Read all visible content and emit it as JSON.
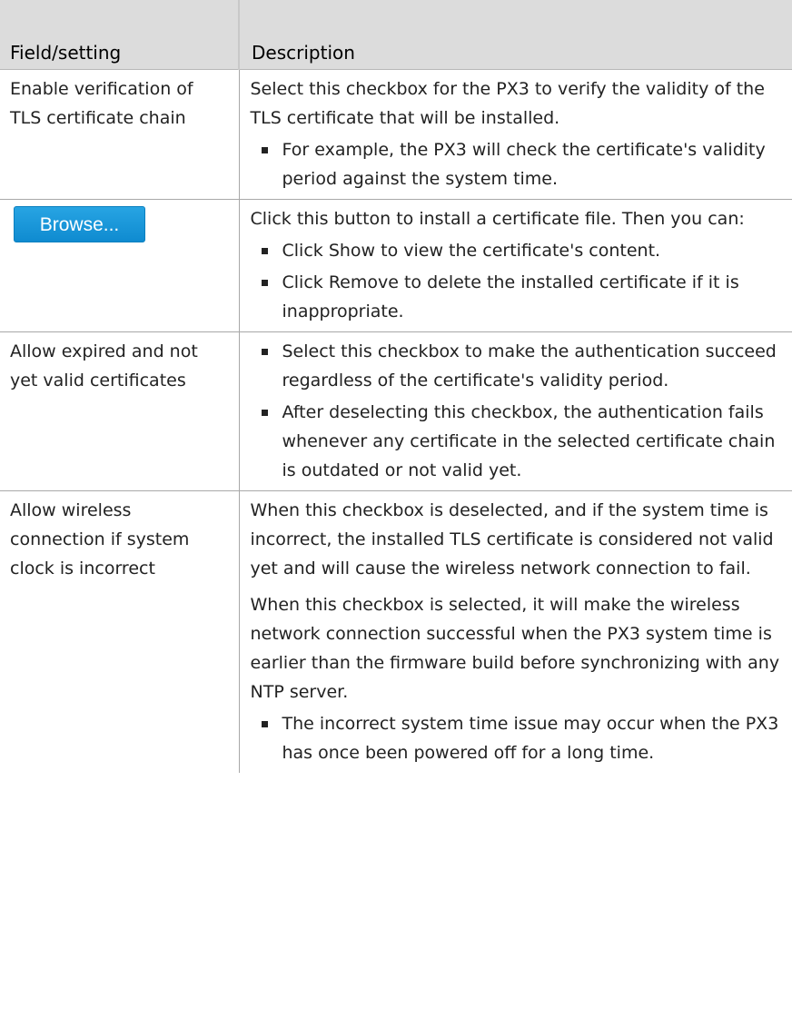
{
  "table": {
    "headers": [
      "Field/setting",
      "Description"
    ],
    "rows": [
      {
        "field": "Enable verification of TLS certificate chain",
        "paragraphs": [
          "Select this checkbox for the PX3 to verify the validity of the TLS certificate that will be installed."
        ],
        "bullets": [
          "For example, the PX3 will check the certificate's validity period against the system time."
        ]
      },
      {
        "field_button": "Browse...",
        "paragraphs": [
          "Click this button to install a certificate file. Then you can:"
        ],
        "bullets": [
          "Click Show to view the certificate's content.",
          "Click Remove to delete the installed certificate if it is inappropriate."
        ]
      },
      {
        "field": "Allow expired and not yet valid certificates",
        "paragraphs": [],
        "bullets": [
          "Select this checkbox to make the authentication succeed regardless of the certificate's validity period.",
          "After deselecting this checkbox, the authentication fails whenever any certificate in the selected certificate chain is outdated or not valid yet."
        ]
      },
      {
        "field": "Allow wireless connection if system clock is incorrect",
        "paragraphs": [
          "When this checkbox is deselected, and if the system time is incorrect, the installed TLS certificate is considered not valid yet and will cause the wireless network connection to fail.",
          "When this checkbox is selected, it will make the wireless network connection successful when the PX3 system time is earlier than the firmware build before synchronizing with any NTP server."
        ],
        "bullets": [
          "The incorrect system time issue may occur when the PX3 has once been powered off for a long time."
        ]
      }
    ]
  }
}
